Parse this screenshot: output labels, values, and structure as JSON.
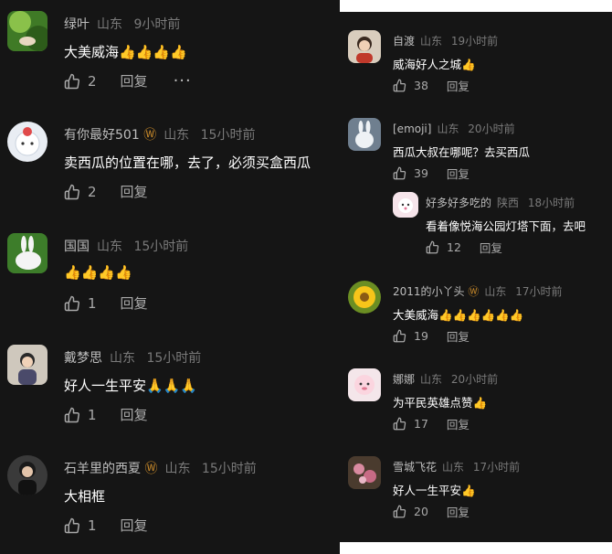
{
  "reply_label": "回复",
  "left_comments": [
    {
      "user": "绿叶",
      "badge": "",
      "location": "山东",
      "time": "9小时前",
      "text": "大美威海👍👍👍👍",
      "likes": "2",
      "has_more": true
    },
    {
      "user": "有你最好501",
      "badge": "Ⓦ",
      "location": "山东",
      "time": "15小时前",
      "text": "卖西瓜的位置在哪，去了，必须买盒西瓜",
      "likes": "2"
    },
    {
      "user": "国国",
      "badge": "",
      "location": "山东",
      "time": "15小时前",
      "text": "👍👍👍👍",
      "likes": "1"
    },
    {
      "user": "戴梦思",
      "badge": "",
      "location": "山东",
      "time": "15小时前",
      "text": "好人一生平安🙏🙏🙏",
      "likes": "1"
    },
    {
      "user": "石羊里的西夏",
      "badge": "Ⓦ",
      "location": "山东",
      "time": "15小时前",
      "text": "大相框",
      "likes": "1"
    }
  ],
  "more_label": "···",
  "right_comments": [
    {
      "user": "自渡",
      "badge": "",
      "location": "山东",
      "time": "19小时前",
      "text": "威海好人之城👍",
      "likes": "38"
    },
    {
      "user": "[emoji]",
      "badge": "",
      "location": "山东",
      "time": "20小时前",
      "text": "西瓜大叔在哪呢？去买西瓜",
      "likes": "39"
    },
    {
      "user": "好多好多吃的",
      "badge": "",
      "location": "陕西",
      "time": "18小时前",
      "text": "看着像悦海公园灯塔下面，去吧",
      "likes": "12",
      "reply": true
    },
    {
      "user": "2011的小丫头",
      "badge": "Ⓦ",
      "location": "山东",
      "time": "17小时前",
      "text": "大美威海👍👍👍👍👍👍",
      "likes": "19"
    },
    {
      "user": "娜娜",
      "badge": "",
      "location": "山东",
      "time": "20小时前",
      "text": "为平民英雄点赞👍",
      "likes": "17"
    },
    {
      "user": "雪城飞花",
      "badge": "",
      "location": "山东",
      "time": "17小时前",
      "text": "好人一生平安👍",
      "likes": "20"
    }
  ],
  "colors": {
    "background": "#151515",
    "username": "#bdbdbd",
    "meta": "#7a7a7a",
    "text": "#ffffff",
    "action": "#a9a9a9",
    "badge": "#c98a2a"
  },
  "icons": [
    "thumbs-up-icon",
    "more-options-icon",
    "avatar"
  ]
}
